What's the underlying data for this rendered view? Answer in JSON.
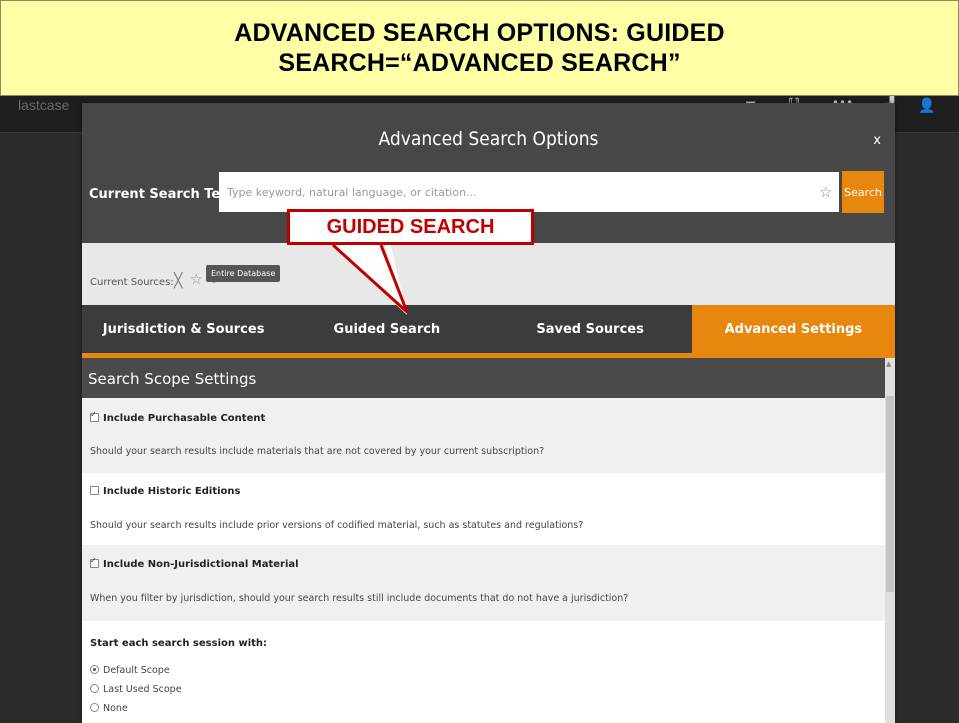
{
  "slide": {
    "title_line1": "ADVANCED SEARCH OPTIONS: GUIDED",
    "title_line2": "SEARCH=“ADVANCED SEARCH”"
  },
  "app": {
    "logo_prefix": "last",
    "logo_suffix": "case"
  },
  "modal": {
    "title": "Advanced Search Options",
    "close": "x",
    "search_terms_label": "Current Search Terms:",
    "search_placeholder": "Type keyword, natural language, or citation...",
    "search_button": "Search",
    "current_sources_label": "Current Sources:",
    "entire_database_badge": "Entire Database",
    "tabs": [
      {
        "label": "Jurisdiction & Sources",
        "active": false
      },
      {
        "label": "Guided Search",
        "active": false
      },
      {
        "label": "Saved Sources",
        "active": false
      },
      {
        "label": "Advanced Settings",
        "active": true
      }
    ],
    "scope_header": "Search Scope Settings",
    "options": [
      {
        "title": "Include Purchasable Content",
        "checked": true,
        "description": "Should your search results include materials that are not covered by your current subscription?"
      },
      {
        "title": "Include Historic Editions",
        "checked": false,
        "description": "Should your search results include prior versions of codified material, such as statutes and regulations?"
      },
      {
        "title": "Include Non-Jurisdictional Material",
        "checked": true,
        "description": "When you filter by jurisdiction, should your search results still include documents that do not have a jurisdiction?"
      }
    ],
    "session_label": "Start each search session with:",
    "session_options": [
      {
        "label": "Default Scope",
        "selected": true
      },
      {
        "label": "Last Used Scope",
        "selected": false
      },
      {
        "label": "None",
        "selected": false
      }
    ]
  },
  "callout": {
    "text": "GUIDED SEARCH"
  },
  "colors": {
    "accent": "#e8870e",
    "callout_red": "#c00000",
    "banner_yellow": "#ffffa6"
  }
}
